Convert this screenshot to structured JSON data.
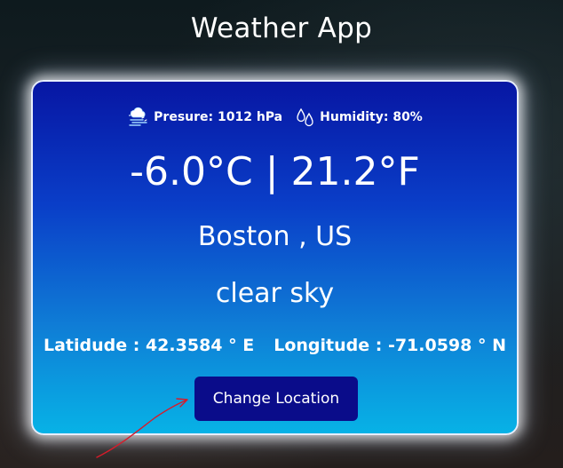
{
  "app": {
    "title": "Weather App"
  },
  "weather": {
    "pressure": "Presure: 1012 hPa",
    "humidity": "Humidity: 80%",
    "temperature": "-6.0°C | 21.2°F",
    "location": "Boston , US",
    "description": "clear sky",
    "latitude": "Latidude : 42.3584 ° E",
    "longitude": "Longitude : -71.0598 ° N"
  },
  "actions": {
    "change_location": "Change Location"
  },
  "icons": {
    "pressure": "cloud-snow-icon",
    "humidity": "droplets-icon",
    "annotation": "red-arrow-annotation"
  },
  "colors": {
    "card_top": "#0716a3",
    "card_bottom": "#07b2e6",
    "button": "#0a0c8a",
    "arrow": "#d81b2a"
  }
}
